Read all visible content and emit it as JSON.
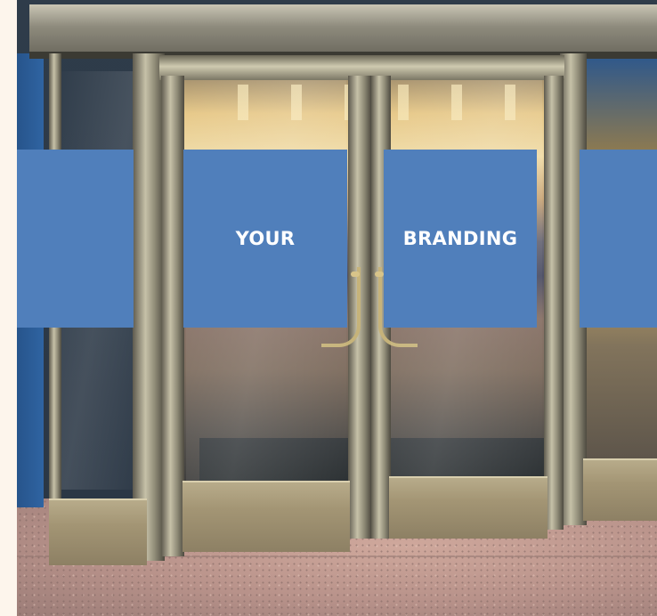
{
  "branding": {
    "panel_left_text": "",
    "panel_door_left_text": "YOUR",
    "panel_door_right_text": "BRANDING",
    "panel_right_text": "",
    "panel_color": "#507fbb",
    "text_color": "#ffffff"
  },
  "scene": {
    "subject": "glass-and-steel-entrance-doors",
    "floor_color": "#b8928a",
    "frame_color": "#a8a28a"
  }
}
